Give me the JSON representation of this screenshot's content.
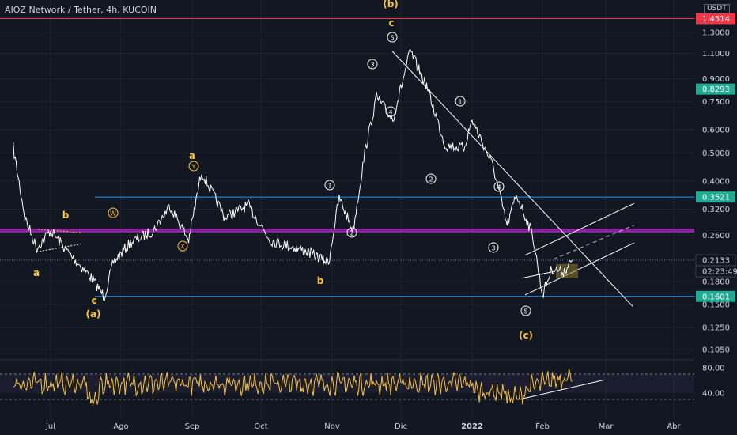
{
  "chart_data": {
    "type": "line",
    "title": "AIOZ Network / Tether, 4h, KUCOIN",
    "currency": "USDT",
    "price_scale": "log",
    "x_axis": {
      "ticks": [
        "Jul",
        "Ago",
        "Sep",
        "Oct",
        "Nov",
        "Dic",
        "2022",
        "Feb",
        "Mar",
        "Abr"
      ]
    },
    "y_axis_price": {
      "ticks": [
        "1.3000",
        "1.1000",
        "0.9000",
        "0.7500",
        "0.6000",
        "0.5000",
        "0.4000",
        "0.3200",
        "0.2600",
        "0.1800",
        "0.1500",
        "0.1250",
        "0.1050"
      ]
    },
    "y_axis_rsi": {
      "ticks": [
        "80.00",
        "40.00"
      ]
    },
    "price_badges": [
      {
        "value": "1.4514",
        "color": "#f23645"
      },
      {
        "value": "0.8293",
        "color": "#22ab94"
      },
      {
        "value": "0.3521",
        "color": "#22ab94"
      },
      {
        "value": "0.2133",
        "color": "#131722"
      },
      {
        "value": "02:23:49",
        "color": "#131722"
      },
      {
        "value": "0.1601",
        "color": "#22ab94"
      }
    ],
    "price_series_approx": [
      {
        "date": "Jun 15",
        "price": 0.52
      },
      {
        "date": "Jun 20",
        "price": 0.3
      },
      {
        "date": "Jun 25",
        "price": 0.235
      },
      {
        "date": "Jul 1",
        "price": 0.27
      },
      {
        "date": "Jul 10",
        "price": 0.22
      },
      {
        "date": "Jul 18",
        "price": 0.188
      },
      {
        "date": "Jul 24",
        "price": 0.16
      },
      {
        "date": "Jul 28",
        "price": 0.21
      },
      {
        "date": "Aug 5",
        "price": 0.245
      },
      {
        "date": "Aug 15",
        "price": 0.27
      },
      {
        "date": "Aug 22",
        "price": 0.33
      },
      {
        "date": "Aug 30",
        "price": 0.25
      },
      {
        "date": "Sep 5",
        "price": 0.43
      },
      {
        "date": "Sep 15",
        "price": 0.3
      },
      {
        "date": "Sep 25",
        "price": 0.33
      },
      {
        "date": "Oct 5",
        "price": 0.25
      },
      {
        "date": "Oct 20",
        "price": 0.23
      },
      {
        "date": "Oct 30",
        "price": 0.21
      },
      {
        "date": "Nov 4",
        "price": 0.35
      },
      {
        "date": "Nov 10",
        "price": 0.27
      },
      {
        "date": "Nov 15",
        "price": 0.5
      },
      {
        "date": "Nov 20",
        "price": 0.78
      },
      {
        "date": "Nov 27",
        "price": 0.65
      },
      {
        "date": "Dec 5",
        "price": 1.12
      },
      {
        "date": "Dec 12",
        "price": 0.85
      },
      {
        "date": "Dec 20",
        "price": 0.53
      },
      {
        "date": "Dec 28",
        "price": 0.52
      },
      {
        "date": "Jan 1",
        "price": 0.65
      },
      {
        "date": "Jan 10",
        "price": 0.45
      },
      {
        "date": "Jan 16",
        "price": 0.28
      },
      {
        "date": "Jan 20",
        "price": 0.36
      },
      {
        "date": "Jan 27",
        "price": 0.26
      },
      {
        "date": "Feb 1",
        "price": 0.162
      },
      {
        "date": "Feb 5",
        "price": 0.2
      },
      {
        "date": "Feb 10",
        "price": 0.195
      },
      {
        "date": "Feb 14",
        "price": 0.2133
      }
    ],
    "horizontal_levels": [
      {
        "value": 1.4514,
        "color": "#f23645"
      },
      {
        "value": 0.3521,
        "color": "#2196f3"
      },
      {
        "value": 0.27,
        "color": "#9c27b0"
      },
      {
        "value": 0.1601,
        "color": "#2196f3"
      }
    ],
    "wave_labels": [
      {
        "text": "a",
        "color": "#f6c343"
      },
      {
        "text": "b",
        "color": "#f6c343"
      },
      {
        "text": "c",
        "color": "#f6c343"
      },
      {
        "text": "(a)",
        "color": "#f6c343"
      },
      {
        "text": "a",
        "color": "#f6c343"
      },
      {
        "text": "b",
        "color": "#f6c343"
      },
      {
        "text": "c",
        "color": "#f6c343"
      },
      {
        "text": "(b)",
        "color": "#f6c343"
      },
      {
        "text": "(c)",
        "color": "#f6c343"
      },
      {
        "text": "W",
        "color": "#f6c343"
      },
      {
        "text": "X",
        "color": "#f6c343"
      },
      {
        "text": "Y",
        "color": "#f6c343"
      },
      {
        "text": "1",
        "color": "#ffffff"
      },
      {
        "text": "2",
        "color": "#ffffff"
      },
      {
        "text": "3",
        "color": "#ffffff"
      },
      {
        "text": "4",
        "color": "#ffffff"
      },
      {
        "text": "5",
        "color": "#ffffff"
      },
      {
        "text": "1",
        "color": "#ffffff"
      },
      {
        "text": "2",
        "color": "#ffffff"
      },
      {
        "text": "3",
        "color": "#ffffff"
      },
      {
        "text": "4",
        "color": "#ffffff"
      },
      {
        "text": "5",
        "color": "#ffffff"
      }
    ],
    "rsi_range": [
      20,
      100
    ],
    "colors": {
      "background": "#131722",
      "price_line": "#ffffff",
      "rsi_line": "#f6c343",
      "trend_lines": "#ffffff",
      "grid": "#1e222d"
    }
  }
}
